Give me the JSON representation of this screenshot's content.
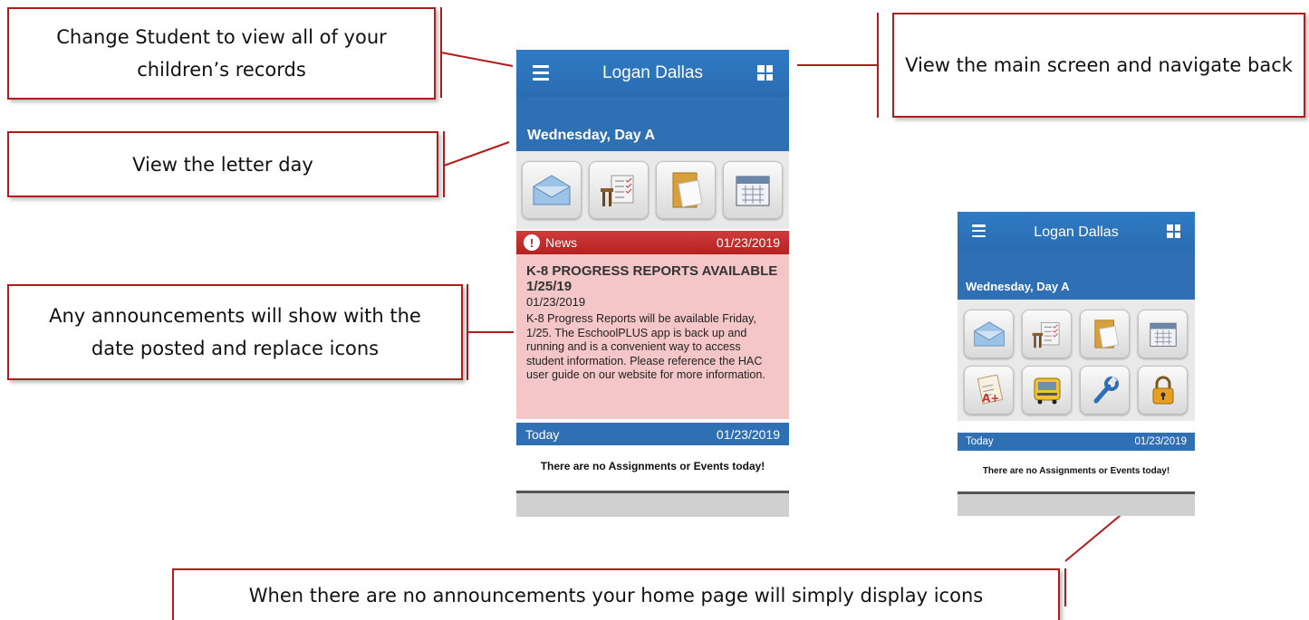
{
  "callouts": {
    "change_student": "Change Student to view all of your children’s records",
    "main_screen": "View the main screen and navigate back",
    "letter_day": "View the letter day",
    "announcements": "Any announcements will show with the date posted and replace icons",
    "no_announcements": "When there are no announcements your home page will simply display icons"
  },
  "phone1": {
    "student_name": "Logan Dallas",
    "day_label": "Wednesday, Day A",
    "icons": [
      "mail-icon",
      "checklist-desk-icon",
      "folder-icon",
      "calendar-icon"
    ],
    "news": {
      "label": "News",
      "date": "01/23/2019",
      "title": "K-8 PROGRESS REPORTS AVAILABLE 1/25/19",
      "posted": "01/23/2019",
      "body": "K-8 Progress Reports will be available Friday, 1/25. The EschoolPLUS app is back up and running and is a convenient way to access student information. Please reference the HAC user guide on our website for more information."
    },
    "today_label": "Today",
    "today_date": "01/23/2019",
    "no_items": "There are no Assignments or Events today!"
  },
  "phone2": {
    "student_name": "Logan Dallas",
    "day_label": "Wednesday, Day A",
    "icons": [
      "mail-icon",
      "checklist-desk-icon",
      "folder-icon",
      "calendar-icon",
      "report-card-icon",
      "bus-icon",
      "wrench-icon",
      "lock-icon"
    ],
    "today_label": "Today",
    "today_date": "01/23/2019",
    "no_items": "There are no Assignments or Events today!"
  },
  "colors": {
    "header_blue": "#2f6fb4",
    "news_red": "#b32222",
    "news_bg": "#f4c6c8",
    "callout_border": "#b31b1b"
  }
}
